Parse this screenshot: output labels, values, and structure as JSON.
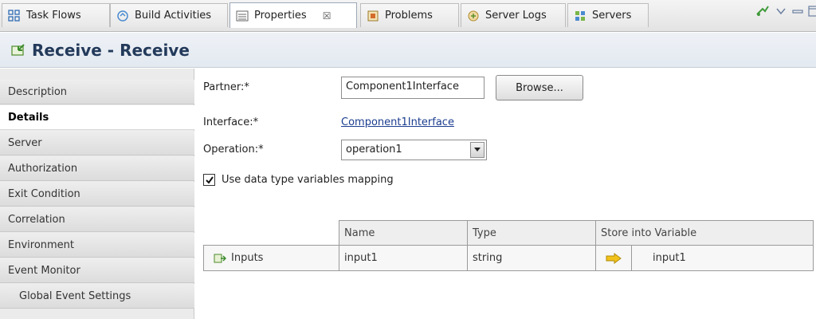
{
  "tabs": [
    {
      "label": "Task Flows",
      "icon": "task-flows-icon"
    },
    {
      "label": "Build Activities",
      "icon": "build-activities-icon"
    },
    {
      "label": "Properties",
      "icon": "properties-icon",
      "active": true,
      "close": "☒"
    },
    {
      "label": "Problems",
      "icon": "problems-icon"
    },
    {
      "label": "Server Logs",
      "icon": "server-logs-icon"
    },
    {
      "label": "Servers",
      "icon": "servers-icon"
    }
  ],
  "header": {
    "title": "Receive - Receive",
    "icon": "receive-icon"
  },
  "nav": {
    "items": [
      {
        "label": "Description"
      },
      {
        "label": "Details",
        "selected": true
      },
      {
        "label": "Server"
      },
      {
        "label": "Authorization"
      },
      {
        "label": "Exit Condition"
      },
      {
        "label": "Correlation"
      },
      {
        "label": "Environment"
      },
      {
        "label": "Event Monitor"
      },
      {
        "label": "Global Event Settings",
        "sub": true
      }
    ]
  },
  "form": {
    "partner_label": "Partner:*",
    "partner_value": "Component1Interface",
    "browse_label": "Browse...",
    "interface_label": "Interface:*",
    "interface_link": "Component1Interface",
    "operation_label": "Operation:*",
    "operation_value": "operation1",
    "checkbox_checked": true,
    "checkbox_label": "Use data type variables mapping"
  },
  "table": {
    "headers": [
      "Name",
      "Type",
      "Store into Variable"
    ],
    "row": {
      "group": "Inputs",
      "name": "input1",
      "type": "string",
      "variable": "input1"
    }
  },
  "colors": {
    "accent": "#1b3d8f",
    "header_title": "#233a5a",
    "arrow": "#f2c21b"
  }
}
